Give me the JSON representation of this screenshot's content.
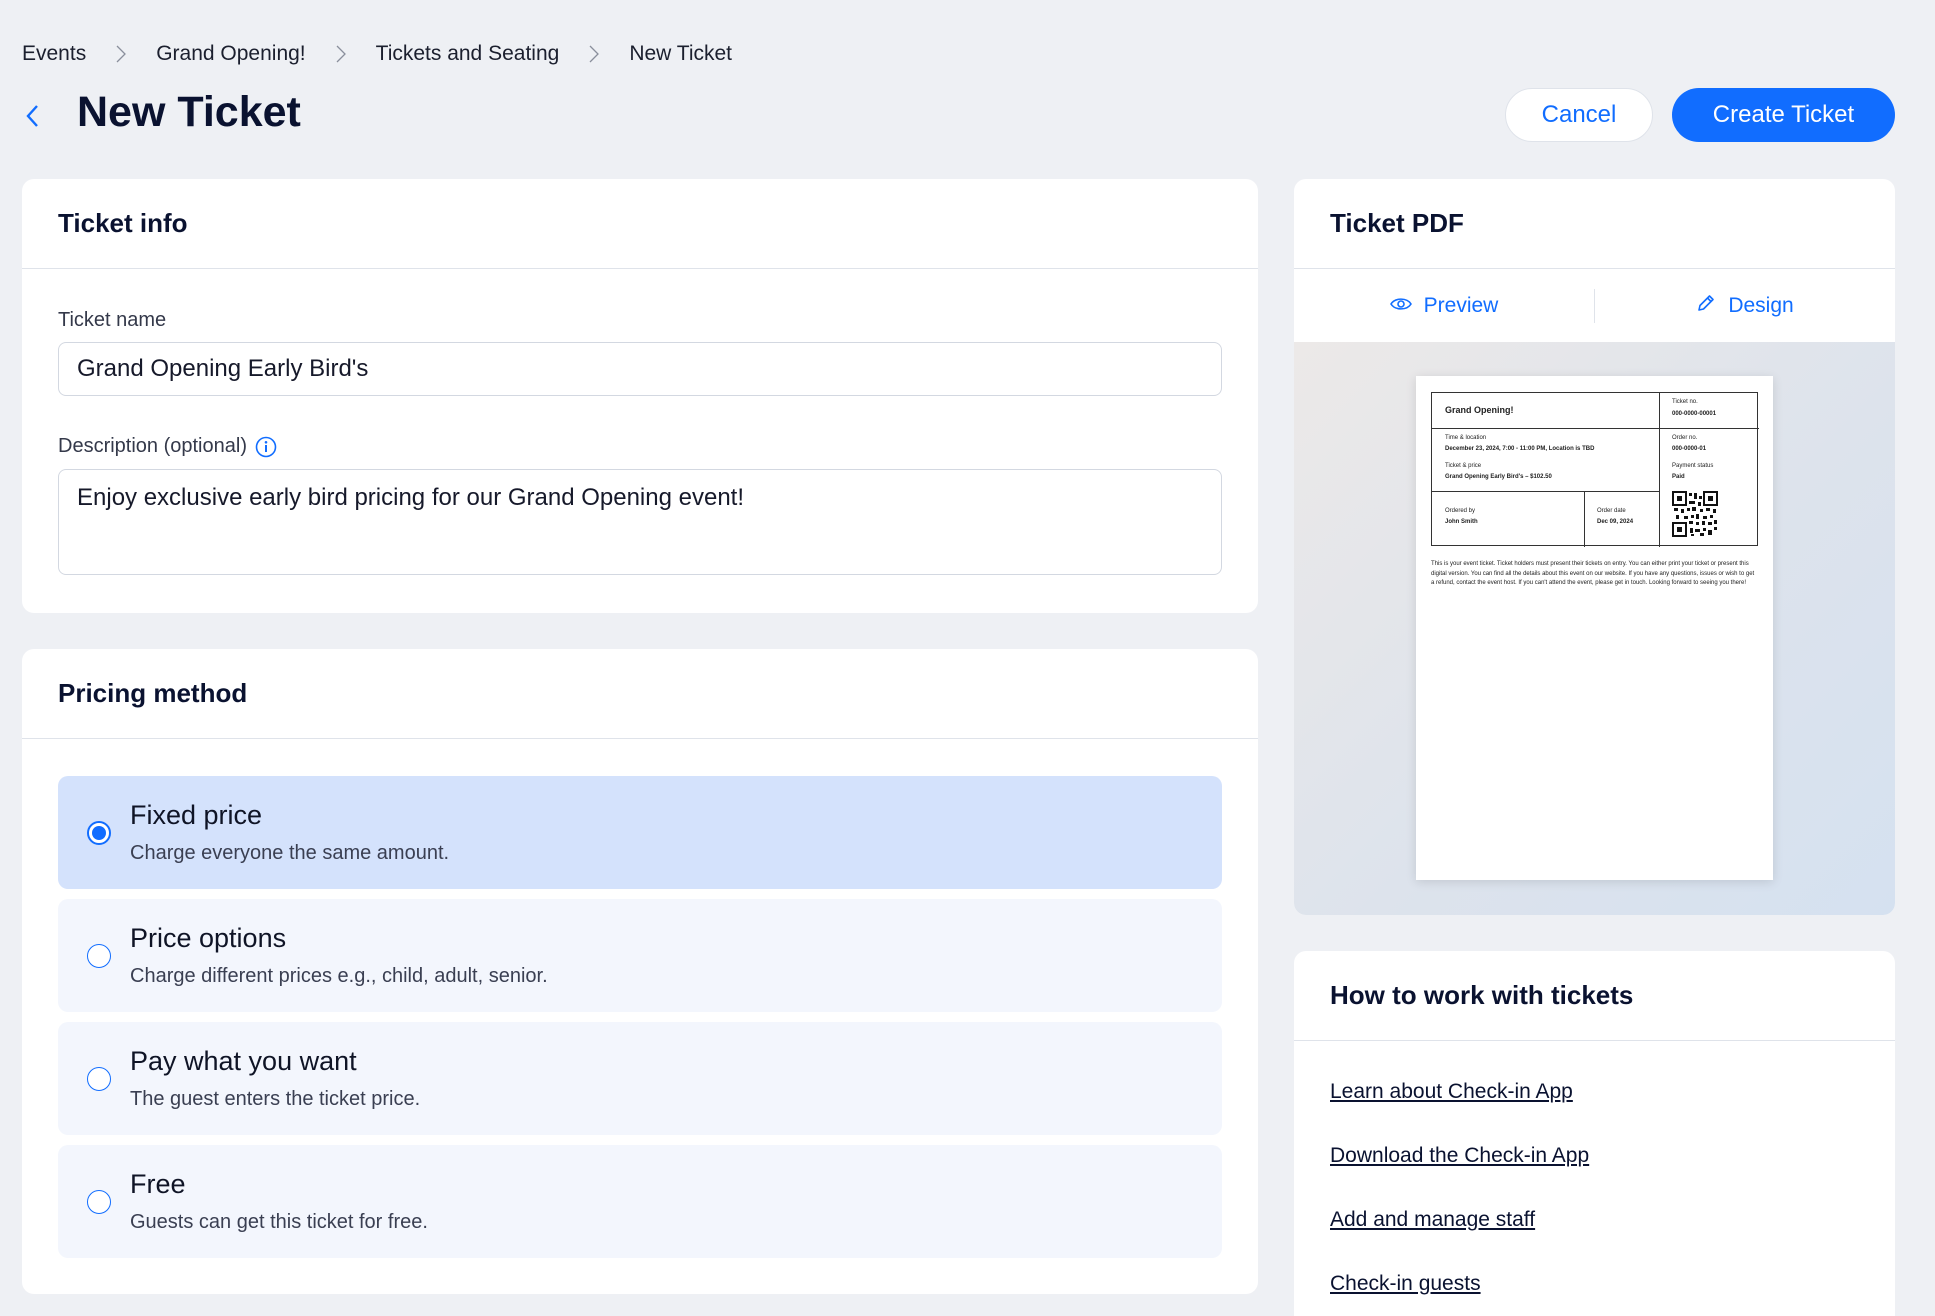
{
  "breadcrumb": [
    "Events",
    "Grand Opening!",
    "Tickets and Seating",
    "New Ticket"
  ],
  "header": {
    "title": "New Ticket",
    "cancel_label": "Cancel",
    "create_label": "Create Ticket"
  },
  "ticket_info": {
    "title": "Ticket info",
    "name_label": "Ticket name",
    "name_value": "Grand Opening Early Bird's",
    "desc_label": "Description (optional)",
    "desc_value": "Enjoy exclusive early bird pricing for our Grand Opening event!"
  },
  "pricing": {
    "title": "Pricing method",
    "selected": 0,
    "options": [
      {
        "title": "Fixed price",
        "desc": "Charge everyone the same amount."
      },
      {
        "title": "Price options",
        "desc": "Charge different prices e.g., child, adult, senior."
      },
      {
        "title": "Pay what you want",
        "desc": "The guest enters the ticket price."
      },
      {
        "title": "Free",
        "desc": "Guests can get this ticket for free."
      }
    ]
  },
  "ticket_pdf": {
    "title": "Ticket PDF",
    "preview_label": "Preview",
    "design_label": "Design",
    "sample": {
      "event_name": "Grand Opening!",
      "ticket_no_label": "Ticket no.",
      "ticket_no": "000-0000-00001",
      "time_location_label": "Time & location",
      "time_location": "December 23, 2024, 7:00 - 11:00 PM, Location is TBD",
      "order_no_label": "Order no.",
      "order_no": "000-0000-01",
      "ticket_price_label": "Ticket & price",
      "ticket_price": "Grand Opening Early Bird's – $102.50",
      "payment_status_label": "Payment status",
      "payment_status": "Paid",
      "ordered_by_label": "Ordered by",
      "ordered_by": "John Smith",
      "order_date_label": "Order date",
      "order_date": "Dec 09, 2024",
      "footer": "This is your event ticket. Ticket holders must present their tickets on entry. You can either print your ticket or present this digital version. You can find all the details about this event on our website. If you have any questions, issues or wish to get a refund, contact the event host. If you can't attend the event, please get in touch. Looking forward to seeing you there!"
    }
  },
  "howto": {
    "title": "How to work with tickets",
    "links": [
      "Learn about Check-in App",
      "Download the Check-in App",
      "Add and manage staff",
      "Check-in guests"
    ]
  },
  "colors": {
    "accent": "#116dff",
    "background": "#eef0f4",
    "selected_option": "#d4e2fc",
    "option": "#f3f6fd"
  },
  "icons": [
    "chevron-right-icon",
    "back-arrow-icon",
    "info-icon",
    "eye-icon",
    "pencil-icon",
    "qr-code-icon"
  ]
}
